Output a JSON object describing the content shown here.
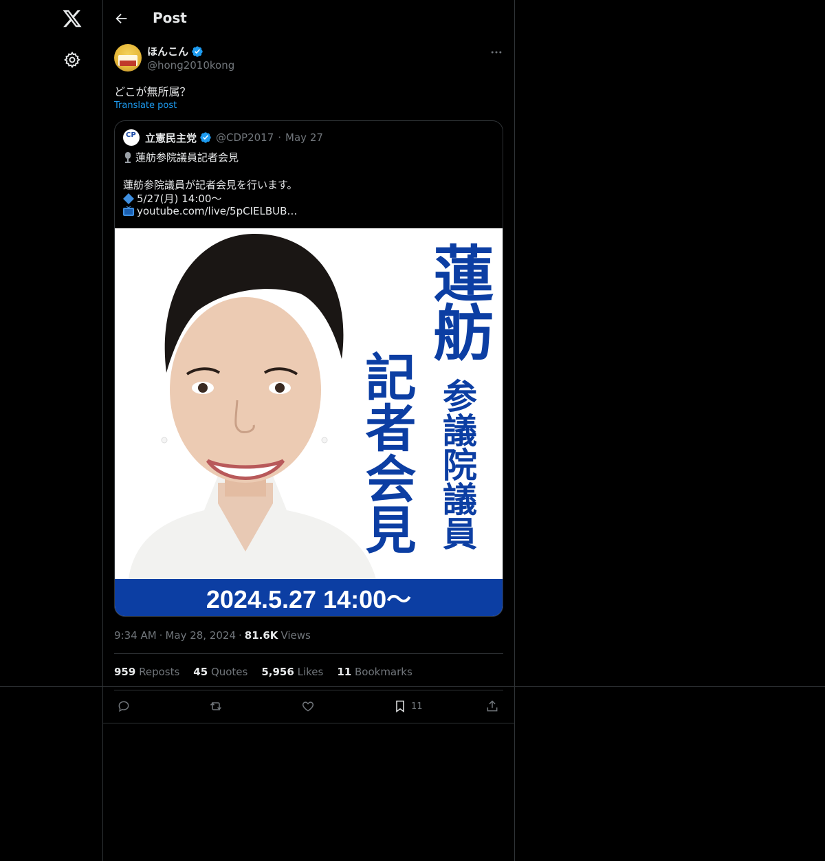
{
  "nav": {
    "logo_icon": "x-logo-icon",
    "settings_icon": "gear-icon"
  },
  "topbar": {
    "title": "Post"
  },
  "post": {
    "author_name": "ほんこん",
    "author_handle": "@hong2010kong",
    "text": "どこが無所属？",
    "translate_label": "Translate post",
    "timestamp": "9:34 AM",
    "date": "May 28, 2024",
    "views_count": "81.6K",
    "views_label": "Views"
  },
  "quote": {
    "author_name": "立憲民主党",
    "author_handle": "@CDP2017",
    "separator": "·",
    "date": "May 27",
    "line1": "蓮舫参院議員記者会見",
    "line2": "蓮舫参院議員が記者会見を行います。",
    "line3": "5/27(月) 14:00〜",
    "line4": "youtube.com/live/5pCIELBUB…",
    "image": {
      "title_big": "蓮舫",
      "title_sub": "参議院議員",
      "title_event": "記者会見",
      "banner": "2024.5.27 14:00〜"
    }
  },
  "stats": {
    "reposts_count": "959",
    "reposts_label": "Reposts",
    "quotes_count": "45",
    "quotes_label": "Quotes",
    "likes_count": "5,956",
    "likes_label": "Likes",
    "bookmarks_count": "11",
    "bookmarks_label": "Bookmarks"
  },
  "actions": {
    "bookmark_count": "11"
  },
  "colors": {
    "accent": "#1d9bf0",
    "background": "#000000",
    "muted": "#71767b",
    "brand_blue": "#0c3ea3"
  }
}
